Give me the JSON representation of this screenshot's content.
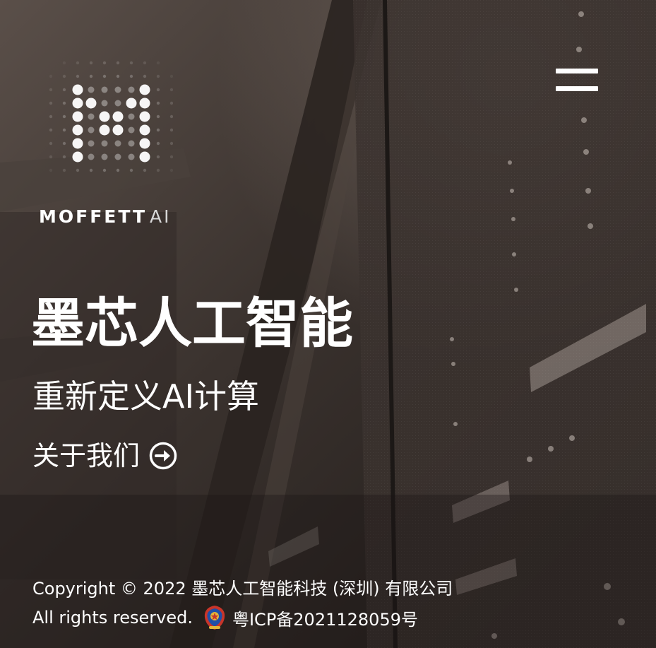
{
  "header": {
    "brand_name": "MOFFETT",
    "brand_suffix": "AI",
    "menu_icon": "hamburger-menu-icon"
  },
  "hero": {
    "title": "墨芯人工智能",
    "subtitle": "重新定义AI计算",
    "cta_label": "关于我们",
    "cta_icon": "arrow-right-circle-icon"
  },
  "footer": {
    "copyright": "Copyright © 2022 墨芯人工智能科技 (深圳) 有限公司",
    "rights": "All rights reserved.",
    "badge_icon": "police-badge-icon",
    "icp": "粤ICP备2021128059号"
  },
  "colors": {
    "background": "#2a2421",
    "text": "#ffffff"
  }
}
